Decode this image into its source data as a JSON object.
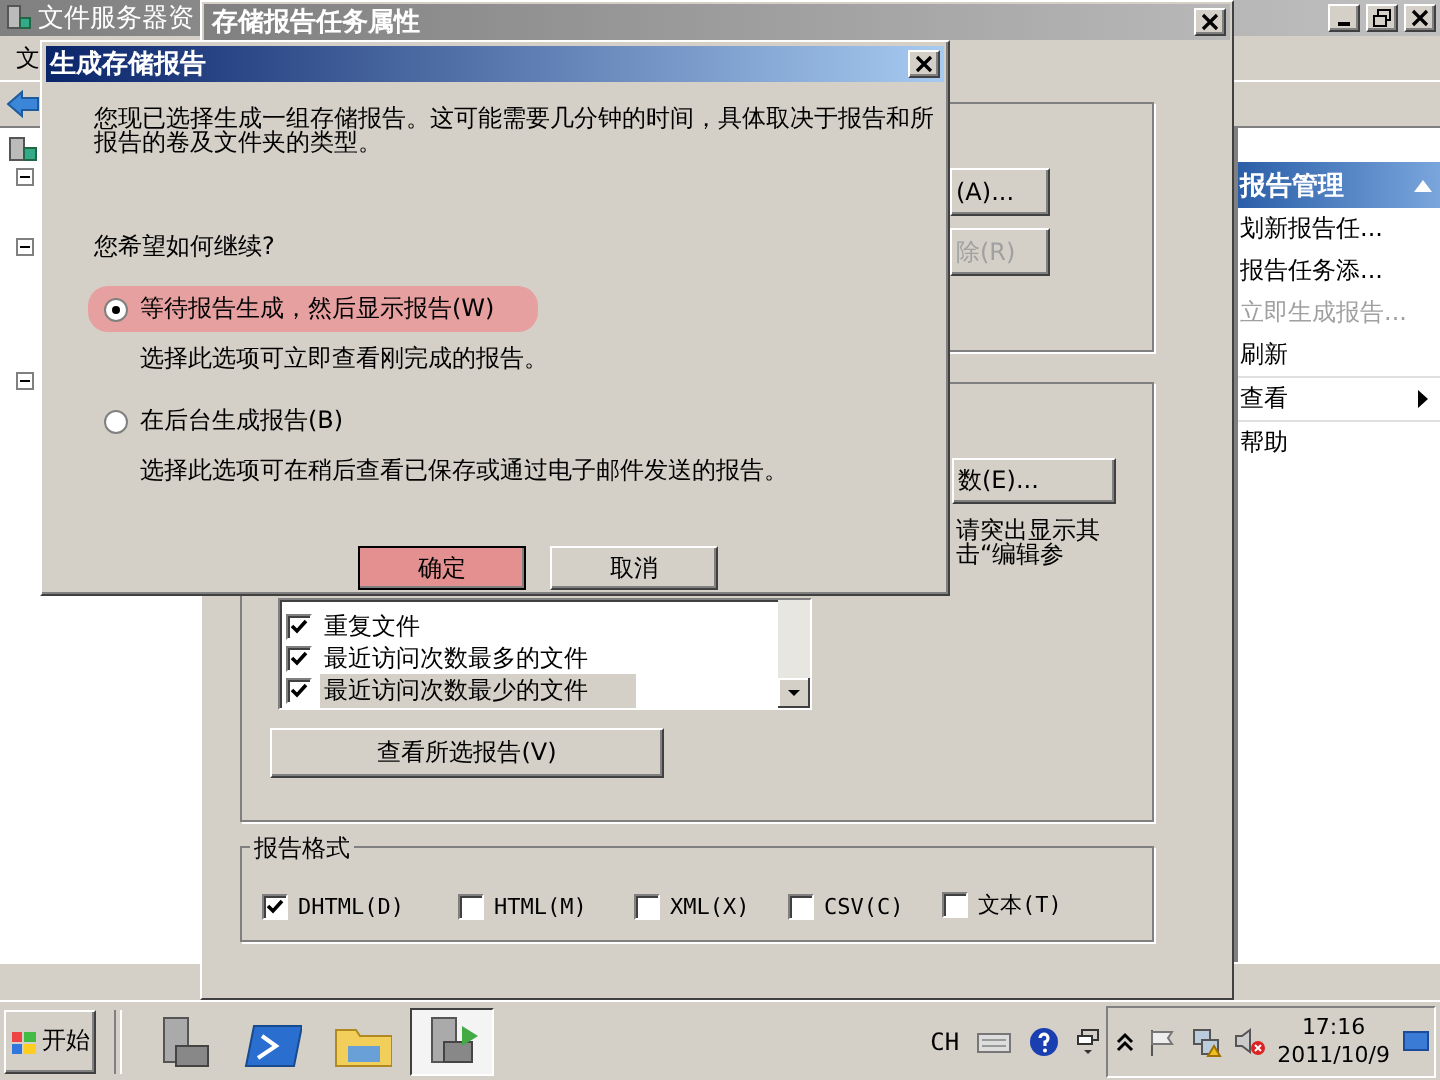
{
  "main_window": {
    "title": "文件服务器资",
    "menu": [
      {
        "label": "文"
      }
    ],
    "actions_pane": {
      "header": "报告管理",
      "items": [
        {
          "label": "划新报告任...",
          "disabled": false,
          "has_submenu": false
        },
        {
          "label": "报告任务添...",
          "disabled": false,
          "has_submenu": false
        },
        {
          "label": "立即生成报告...",
          "disabled": true,
          "has_submenu": false
        },
        {
          "label": "刷新",
          "disabled": false,
          "has_submenu": false
        },
        {
          "label": "查看",
          "disabled": false,
          "has_submenu": true
        },
        {
          "label": "帮助",
          "disabled": false,
          "has_submenu": false
        }
      ]
    }
  },
  "properties_window": {
    "title": "存储报告任务属性",
    "group_buttons": [
      {
        "label": "(A)...",
        "disabled": false
      },
      {
        "label": "除(R)",
        "disabled": true
      }
    ],
    "edit_button": {
      "label": "数(E)...",
      "disabled": false
    },
    "hint_lines": [
      "请突出显示其",
      "击“编辑参"
    ],
    "report_list": [
      {
        "label": "重复文件",
        "checked": true,
        "selected": false
      },
      {
        "label": "最近访问次数最多的文件",
        "checked": true,
        "selected": false
      },
      {
        "label": "最近访问次数最少的文件",
        "checked": true,
        "selected": true
      }
    ],
    "view_button": "查看所选报告(V)",
    "format_group": {
      "title": "报告格式",
      "options": [
        {
          "label": "DHTML(D)",
          "checked": true
        },
        {
          "label": "HTML(M)",
          "checked": false
        },
        {
          "label": "XML(X)",
          "checked": false
        },
        {
          "label": "CSV(C)",
          "checked": false
        },
        {
          "label": "文本(T)",
          "checked": false
        }
      ]
    }
  },
  "dialog": {
    "title": "生成存储报告",
    "message": "您现已选择生成一组存储报告。这可能需要几分钟的时间，具体取决于报告和所报告的卷及文件夹的类型。",
    "question": "您希望如何继续?",
    "options": [
      {
        "label": "等待报告生成，然后显示报告(W)",
        "description": "选择此选项可立即查看刚完成的报告。",
        "selected": true,
        "highlighted": true
      },
      {
        "label": "在后台生成报告(B)",
        "description": "选择此选项可在稍后查看已保存或通过电子邮件发送的报告。",
        "selected": false,
        "highlighted": false
      }
    ],
    "buttons": [
      {
        "label": "确定",
        "highlighted": true
      },
      {
        "label": "取消",
        "highlighted": false
      }
    ]
  },
  "taskbar": {
    "start_label": "开始",
    "apps": [
      {
        "kind": "server-manager",
        "selected": false
      },
      {
        "kind": "powershell",
        "selected": false
      },
      {
        "kind": "explorer",
        "selected": false
      },
      {
        "kind": "fsrm",
        "selected": true
      }
    ],
    "language": "CH",
    "time": "17:16",
    "date": "2011/10/9"
  }
}
